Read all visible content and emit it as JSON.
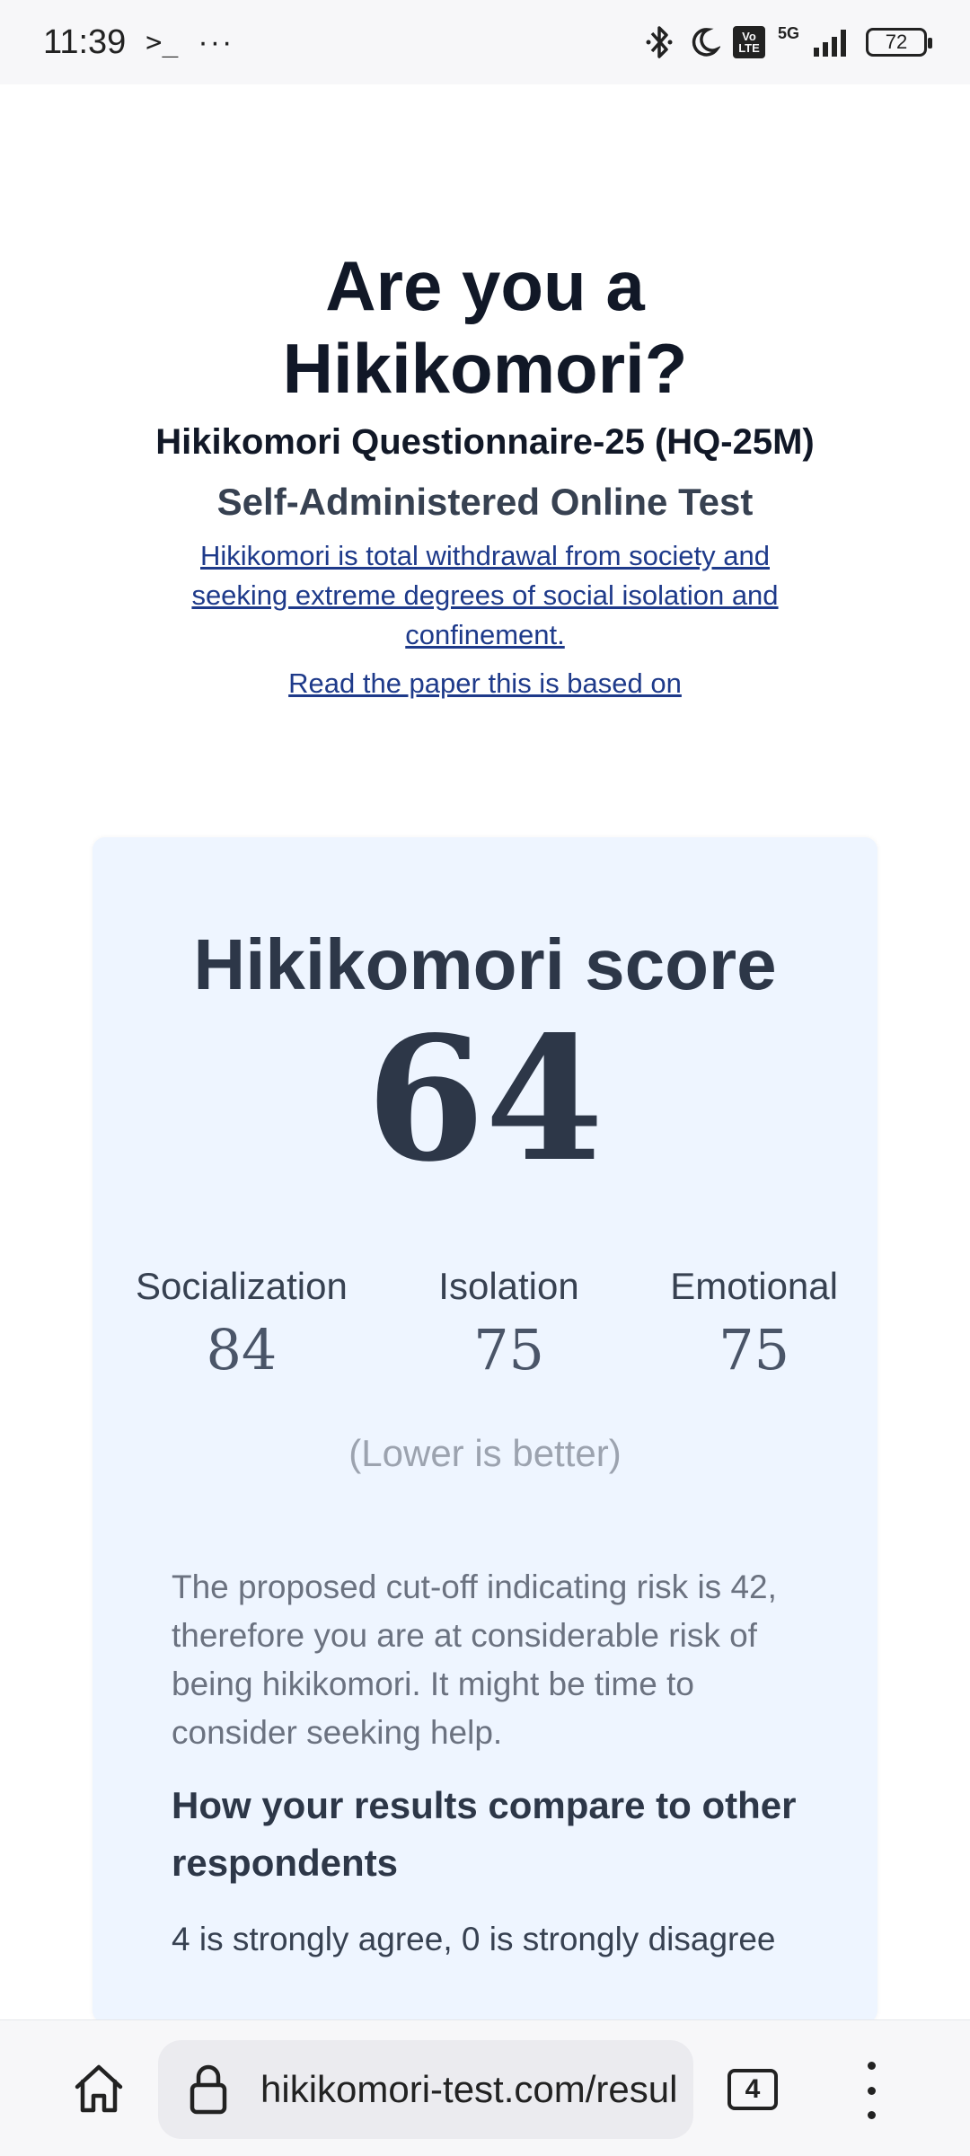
{
  "status_bar": {
    "time": "11:39",
    "terminal_icon": "terminal-icon",
    "more": "···",
    "network": "5G",
    "volte": "Vo LTE",
    "battery": "72"
  },
  "header": {
    "title": "Are you a Hikikomori?",
    "subtitle": "Hikikomori Questionnaire-25 (HQ-25M)",
    "subtitle2": "Self-Administered Online Test",
    "description_link": "Hikikomori is total withdrawal from society and seeking extreme degrees of social isolation and confinement.",
    "paper_link": "Read the paper this is based on"
  },
  "result": {
    "score_label": "Hikikomori score",
    "score_value": "64",
    "subscores": [
      {
        "label": "Socialization",
        "value": "84"
      },
      {
        "label": "Isolation",
        "value": "75"
      },
      {
        "label": "Emotional",
        "value": "75"
      }
    ],
    "lower_note": "(Lower is better)",
    "risk_text": "The proposed cut-off indicating risk is 42, therefore you are at considerable risk of being hikikomori. It might be time to consider seeking help.",
    "compare_heading": "How your results compare to other respondents",
    "scale_text": "4 is strongly agree, 0 is strongly disagree"
  },
  "browser": {
    "url": "hikikomori-test.com/resul",
    "tab_count": "4"
  }
}
